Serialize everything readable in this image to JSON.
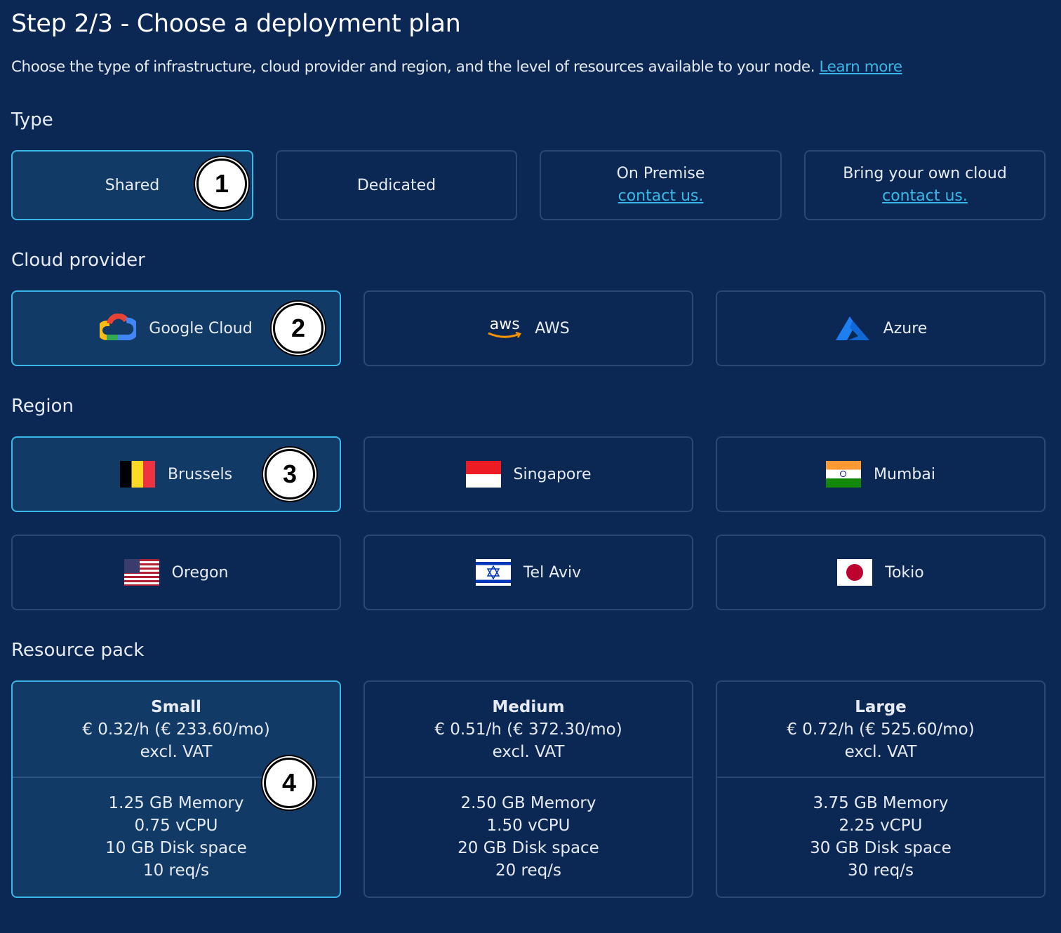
{
  "header": {
    "title": "Step 2/3 - Choose a deployment plan",
    "subtitle": "Choose the type of infrastructure, cloud provider and region, and the level of resources available to your node.",
    "learn_more": "Learn more"
  },
  "type": {
    "label": "Type",
    "options": [
      {
        "label": "Shared",
        "selected": true,
        "badge": "1"
      },
      {
        "label": "Dedicated",
        "selected": false
      },
      {
        "label": "On Premise",
        "link": "contact us.",
        "selected": false
      },
      {
        "label": "Bring your own cloud",
        "link": "contact us.",
        "selected": false
      }
    ]
  },
  "provider": {
    "label": "Cloud provider",
    "options": [
      {
        "label": "Google Cloud",
        "icon": "google-cloud-icon",
        "selected": true,
        "badge": "2"
      },
      {
        "label": "AWS",
        "icon": "aws-icon",
        "icon_text": "aws",
        "selected": false
      },
      {
        "label": "Azure",
        "icon": "azure-icon",
        "selected": false
      }
    ]
  },
  "region": {
    "label": "Region",
    "options": [
      {
        "label": "Brussels",
        "icon": "belgium-flag-icon",
        "selected": true,
        "badge": "3"
      },
      {
        "label": "Singapore",
        "icon": "singapore-flag-icon",
        "selected": false
      },
      {
        "label": "Mumbai",
        "icon": "india-flag-icon",
        "selected": false
      },
      {
        "label": "Oregon",
        "icon": "usa-flag-icon",
        "selected": false
      },
      {
        "label": "Tel Aviv",
        "icon": "israel-flag-icon",
        "selected": false
      },
      {
        "label": "Tokio",
        "icon": "japan-flag-icon",
        "selected": false
      }
    ]
  },
  "resources": {
    "label": "Resource pack",
    "packs": [
      {
        "name": "Small",
        "price": "€ 0.32/h (€ 233.60/mo)",
        "vat": "excl. VAT",
        "memory": "1.25 GB Memory",
        "cpu": "0.75 vCPU",
        "disk": "10 GB Disk space",
        "rate": "10 req/s",
        "selected": true,
        "badge": "4"
      },
      {
        "name": "Medium",
        "price": "€ 0.51/h (€ 372.30/mo)",
        "vat": "excl. VAT",
        "memory": "2.50 GB Memory",
        "cpu": "1.50 vCPU",
        "disk": "20 GB Disk space",
        "rate": "20 req/s",
        "selected": false
      },
      {
        "name": "Large",
        "price": "€ 0.72/h (€ 525.60/mo)",
        "vat": "excl. VAT",
        "memory": "3.75 GB Memory",
        "cpu": "2.25 vCPU",
        "disk": "30 GB Disk space",
        "rate": "30 req/s",
        "selected": false
      }
    ]
  },
  "colors": {
    "background": "#0b2855",
    "selected_bg": "#123a66",
    "accent": "#3ab7e6",
    "border": "#2a4872"
  }
}
